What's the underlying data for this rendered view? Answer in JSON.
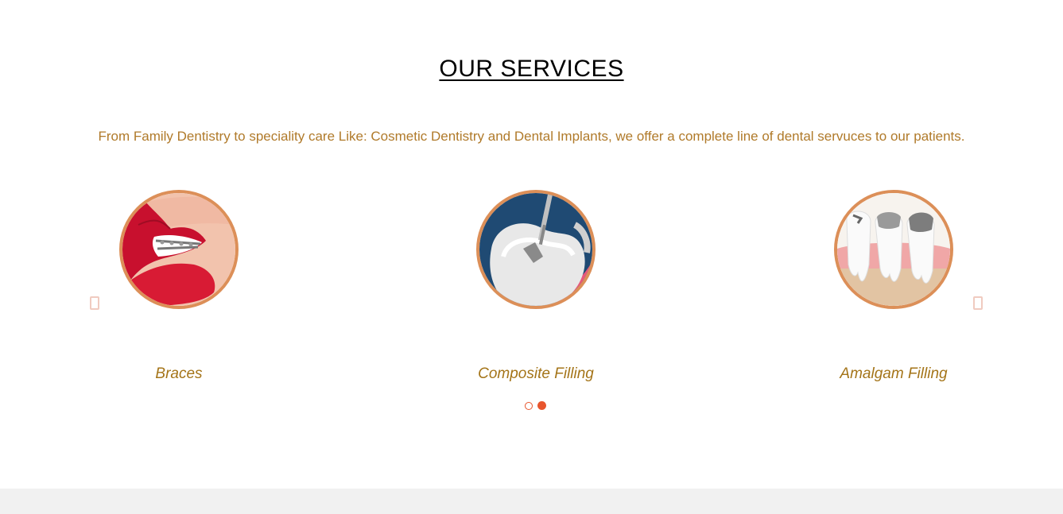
{
  "services": {
    "title": "OUR SERVICES",
    "subtitle": "From Family Dentistry to speciality care Like: Cosmetic Dentistry and Dental Implants, we offer a complete line of dental servuces to our patients.",
    "items": [
      {
        "label": "Braces",
        "image": "braces-lips-image"
      },
      {
        "label": "Composite Filling",
        "image": "composite-filling-tooth-image"
      },
      {
        "label": "Amalgam Filling",
        "image": "amalgam-filling-teeth-image"
      }
    ],
    "pagination": {
      "total": 2,
      "active": 2
    }
  },
  "colors": {
    "accent_border": "#dc8f58",
    "subtitle_text": "#b07a2a",
    "label_text": "#a47418",
    "dot_accent": "#e8552d",
    "footer_bg": "#f1f1f1"
  }
}
